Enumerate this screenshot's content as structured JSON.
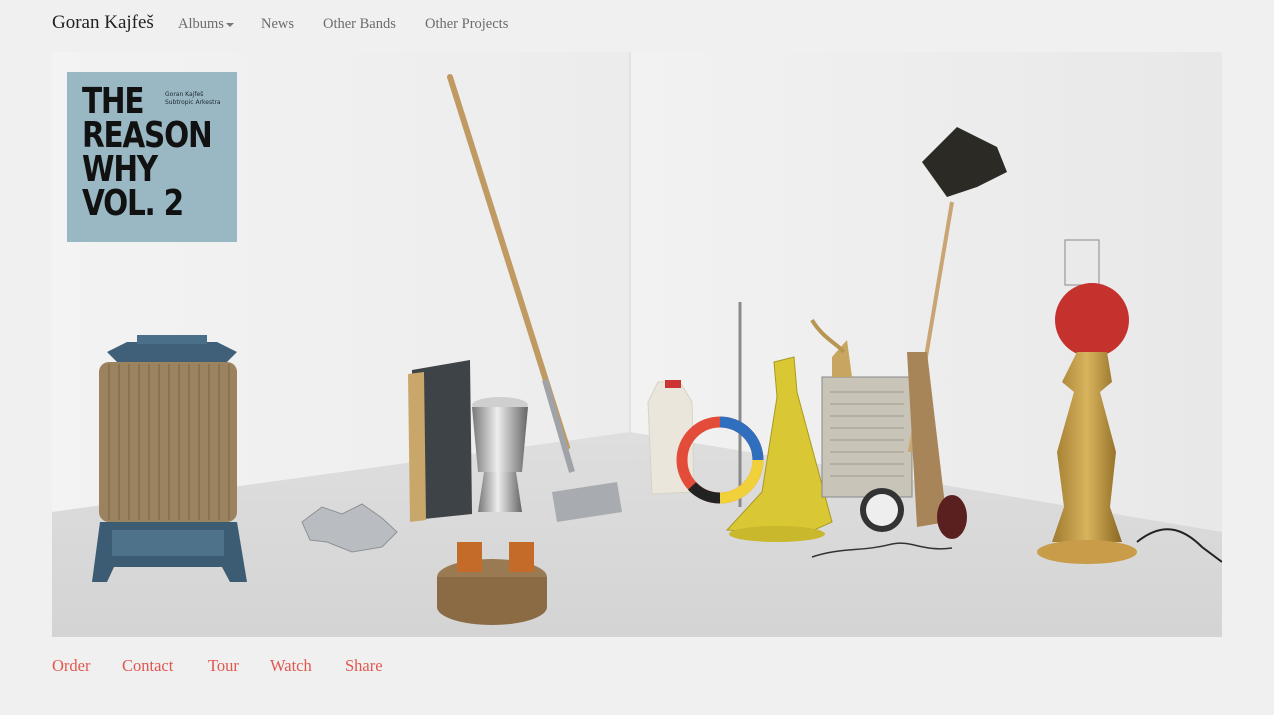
{
  "nav": {
    "brand": "Goran Kajfeš",
    "items": [
      {
        "label": "Albums",
        "has_dropdown": true
      },
      {
        "label": "News"
      },
      {
        "label": "Other Bands"
      },
      {
        "label": "Other Projects"
      }
    ]
  },
  "hero": {
    "album_cover": {
      "title": "THE\nREASON\nWHY\nVOL. 2",
      "credit": "Goran Kajfeš\nSubtropic Arkestra"
    }
  },
  "footer": {
    "links": [
      "Order",
      "Contact",
      "Tour",
      "Watch",
      "Share"
    ]
  },
  "colors": {
    "background": "#f0f0f0",
    "link_accent": "#e0574f",
    "nav_text": "#6b6b6b",
    "brand_text": "#222222",
    "cover_background": "#9ab8c4"
  },
  "icons": {
    "dropdown": "chevron-down-icon"
  }
}
